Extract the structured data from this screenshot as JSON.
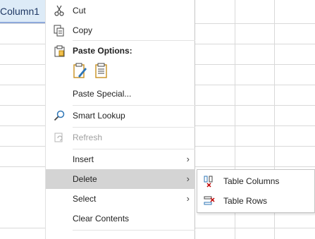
{
  "sheet": {
    "header_cell": "Column1"
  },
  "menu": {
    "cut": {
      "label": "Cut",
      "icon": "scissors-icon"
    },
    "copy": {
      "label": "Copy",
      "icon": "copy-icon"
    },
    "paste_options": {
      "label": "Paste Options:",
      "icon": "clipboard-icon"
    },
    "paste_special": {
      "label": "Paste Special..."
    },
    "smart_lookup": {
      "label": "Smart Lookup",
      "icon": "search-icon"
    },
    "refresh": {
      "label": "Refresh",
      "icon": "refresh-icon",
      "disabled": true
    },
    "insert": {
      "label": "Insert"
    },
    "delete": {
      "label": "Delete",
      "highlighted": true
    },
    "select": {
      "label": "Select"
    },
    "clear_contents": {
      "label": "Clear Contents"
    }
  },
  "submenu": {
    "table_columns": {
      "label": "Table Columns",
      "icon": "delete-table-columns-icon"
    },
    "table_rows": {
      "label": "Table Rows",
      "icon": "delete-table-rows-icon"
    }
  },
  "colors": {
    "header_fill": "#ddebf7",
    "hover_fill": "#d4d4d4",
    "accent_icon": "#2e75b6",
    "delete_mark": "#c00000"
  }
}
